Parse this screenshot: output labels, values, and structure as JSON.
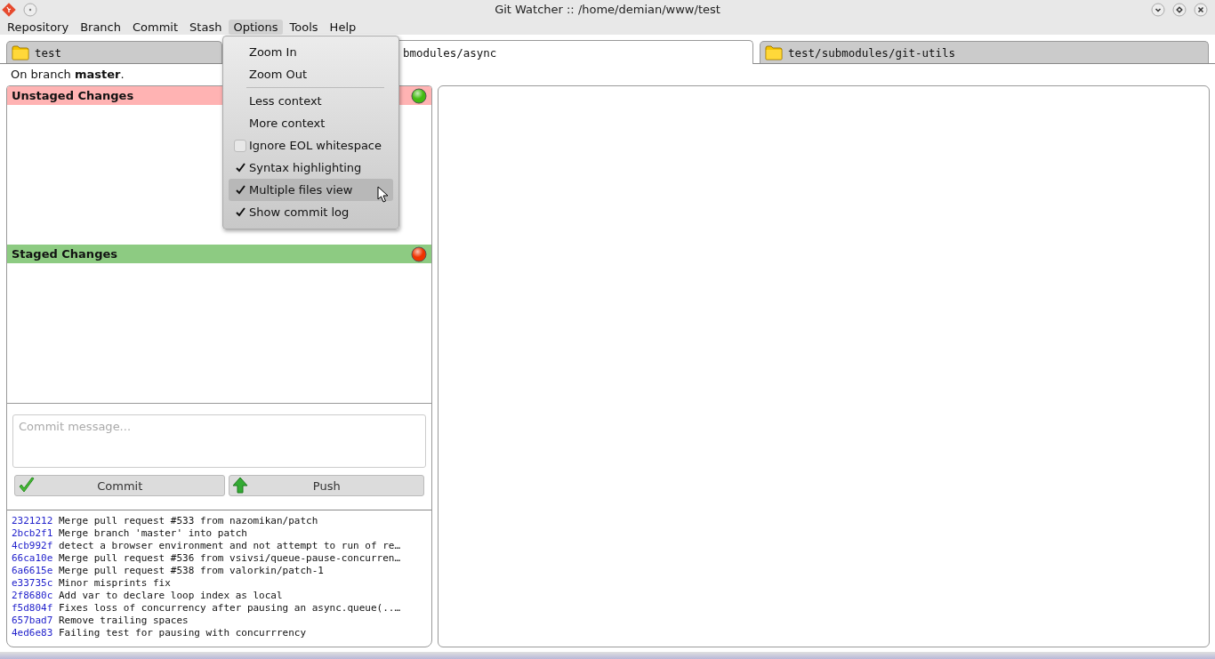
{
  "window": {
    "title": "Git Watcher :: /home/demian/www/test"
  },
  "menubar": [
    {
      "label": "Repository",
      "selected": false
    },
    {
      "label": "Branch",
      "selected": false
    },
    {
      "label": "Commit",
      "selected": false
    },
    {
      "label": "Stash",
      "selected": false
    },
    {
      "label": "Options",
      "selected": true
    },
    {
      "label": "Tools",
      "selected": false
    },
    {
      "label": "Help",
      "selected": false
    }
  ],
  "options_menu": [
    {
      "kind": "action",
      "label": "Zoom In",
      "highlighted": false
    },
    {
      "kind": "action",
      "label": "Zoom Out",
      "highlighted": false
    },
    {
      "kind": "separator"
    },
    {
      "kind": "action",
      "label": "Less context",
      "highlighted": false
    },
    {
      "kind": "action",
      "label": "More context",
      "highlighted": false
    },
    {
      "kind": "check",
      "label": "Ignore EOL whitespace",
      "checked": false,
      "highlighted": false
    },
    {
      "kind": "check",
      "label": "Syntax highlighting",
      "checked": true,
      "highlighted": false
    },
    {
      "kind": "check",
      "label": "Multiple files view",
      "checked": true,
      "highlighted": true
    },
    {
      "kind": "check",
      "label": "Show commit log",
      "checked": true,
      "highlighted": false
    }
  ],
  "tabs": [
    {
      "label": "test",
      "selected": false
    },
    {
      "label": "bmodules/async",
      "selected": true
    },
    {
      "label": "test/submodules/git-utils",
      "selected": false
    }
  ],
  "branch_line": "On branch **master**.",
  "sections": [
    {
      "title": "Unstaged Changes",
      "color": "#ffb3b3",
      "indicator": {
        "color": "#44bb11"
      }
    },
    {
      "title": "Staged Changes",
      "color": "#8dcb82",
      "indicator": {
        "color": "#ee3300"
      }
    }
  ],
  "commit_box": {
    "placeholder": "Commit message..."
  },
  "buttons": [
    {
      "kind": "commit",
      "label": "Commit"
    },
    {
      "kind": "push",
      "label": "Push"
    }
  ],
  "commit_log": [
    {
      "hash": "2321212",
      "message": "Merge pull request #533 from nazomikan/patch"
    },
    {
      "hash": "2bcb2f1",
      "message": "Merge branch 'master' into patch"
    },
    {
      "hash": "4cb992f",
      "message": "detect a browser environment and not attempt to run of re…"
    },
    {
      "hash": "66ca10e",
      "message": "Merge pull request #536 from vsivsi/queue-pause-concurren…"
    },
    {
      "hash": "6a6615e",
      "message": "Merge pull request #538 from valorkin/patch-1"
    },
    {
      "hash": "e33735c",
      "message": "Minor misprints fix"
    },
    {
      "hash": "2f8680c",
      "message": "Add var to declare loop index as local"
    },
    {
      "hash": "f5d804f",
      "message": "Fixes loss of concurrency after pausing an async.queue(..…"
    },
    {
      "hash": "657bad7",
      "message": "Remove trailing spaces"
    },
    {
      "hash": "4ed6e83",
      "message": "Failing test for pausing with concurrrency"
    }
  ]
}
